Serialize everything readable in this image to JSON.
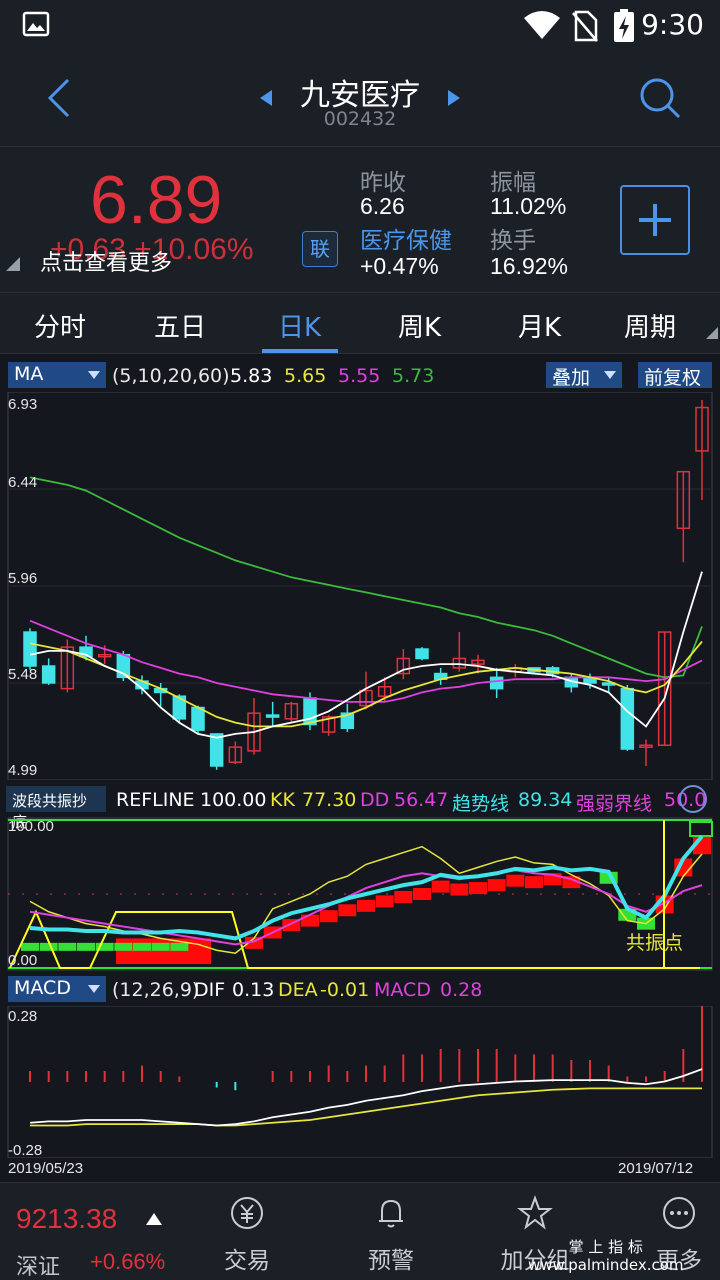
{
  "status_bar": {
    "time": "9:30"
  },
  "header": {
    "stock_name": "九安医疗",
    "stock_code": "002432"
  },
  "quote": {
    "price": "6.89",
    "change": "+0.63  +10.06%",
    "tip": "点击查看更多",
    "link_badge": "联",
    "prev_close_label": "昨收",
    "prev_close": "6.26",
    "amplitude_label": "振幅",
    "amplitude": "11.02%",
    "sector_label": "医疗保健",
    "sector_change": "+0.47%",
    "turnover_label": "换手",
    "turnover": "16.92%",
    "colors": {
      "up": "#e0323c",
      "down": "#41e2e8",
      "accent": "#4b95ea"
    }
  },
  "tabs": [
    "分时",
    "五日",
    "日K",
    "周K",
    "月K",
    "周期"
  ],
  "active_tab": "日K",
  "ma_legend": {
    "selector": "MA",
    "params": "(5,10,20,60)",
    "ma5": "5.83",
    "ma10": "5.65",
    "ma20": "5.55",
    "ma60": "5.73",
    "overlay": "叠加",
    "adjust": "前复权"
  },
  "price_axis": {
    "top": "6.93",
    "mid1": "6.44",
    "mid2": "5.96",
    "mid3": "5.48",
    "bottom": "4.99"
  },
  "indicator_legend": {
    "name": "波段共振抄底",
    "refline_label": "REFLINE",
    "refline": "100.00",
    "kk_label": "KK",
    "kk": "77.30",
    "dd_label": "DD",
    "dd": "56.47",
    "trend_label": "趋势线",
    "trend": "89.34",
    "strength_label": "强弱界线",
    "strength": "50.0",
    "axis_top": "100.00",
    "axis_bottom": "0.00",
    "annotation": "共振点"
  },
  "macd_legend": {
    "selector": "MACD",
    "params": "(12,26,9)",
    "dif_label": "DIF",
    "dif": "0.13",
    "dea_label": "DEA",
    "dea": "-0.01",
    "macd_label": "MACD",
    "macd": "0.28",
    "axis_top": "0.28",
    "axis_bottom": "-0.28"
  },
  "date_axis": {
    "start": "2019/05/23",
    "end": "2019/07/12"
  },
  "chart_data": {
    "type": "candlestick",
    "x_range": [
      "2019/05/23",
      "2019/07/12"
    ],
    "ylim": [
      4.99,
      6.93
    ],
    "candles": [
      {
        "o": 5.7,
        "c": 5.52,
        "h": 5.72,
        "l": 5.5
      },
      {
        "o": 5.52,
        "c": 5.43,
        "h": 5.56,
        "l": 5.42
      },
      {
        "o": 5.4,
        "c": 5.62,
        "h": 5.66,
        "l": 5.38
      },
      {
        "o": 5.62,
        "c": 5.57,
        "h": 5.68,
        "l": 5.55
      },
      {
        "o": 5.58,
        "c": 5.58,
        "h": 5.63,
        "l": 5.53
      },
      {
        "o": 5.58,
        "c": 5.46,
        "h": 5.6,
        "l": 5.44
      },
      {
        "o": 5.44,
        "c": 5.4,
        "h": 5.47,
        "l": 5.37
      },
      {
        "o": 5.4,
        "c": 5.38,
        "h": 5.43,
        "l": 5.3
      },
      {
        "o": 5.36,
        "c": 5.24,
        "h": 5.37,
        "l": 5.22
      },
      {
        "o": 5.3,
        "c": 5.18,
        "h": 5.31,
        "l": 5.16
      },
      {
        "o": 5.16,
        "c": 4.99,
        "h": 5.16,
        "l": 4.97
      },
      {
        "o": 5.01,
        "c": 5.09,
        "h": 5.12,
        "l": 5.0
      },
      {
        "o": 5.07,
        "c": 5.27,
        "h": 5.35,
        "l": 5.05
      },
      {
        "o": 5.26,
        "c": 5.25,
        "h": 5.33,
        "l": 5.2
      },
      {
        "o": 5.24,
        "c": 5.32,
        "h": 5.33,
        "l": 5.22
      },
      {
        "o": 5.35,
        "c": 5.21,
        "h": 5.38,
        "l": 5.18
      },
      {
        "o": 5.17,
        "c": 5.25,
        "h": 5.26,
        "l": 5.15
      },
      {
        "o": 5.27,
        "c": 5.19,
        "h": 5.32,
        "l": 5.17
      },
      {
        "o": 5.31,
        "c": 5.39,
        "h": 5.49,
        "l": 5.29
      },
      {
        "o": 5.36,
        "c": 5.41,
        "h": 5.46,
        "l": 5.33
      },
      {
        "o": 5.48,
        "c": 5.56,
        "h": 5.61,
        "l": 5.45
      },
      {
        "o": 5.61,
        "c": 5.56,
        "h": 5.62,
        "l": 5.55
      },
      {
        "o": 5.48,
        "c": 5.45,
        "h": 5.51,
        "l": 5.42
      },
      {
        "o": 5.51,
        "c": 5.56,
        "h": 5.7,
        "l": 5.49
      },
      {
        "o": 5.53,
        "c": 5.55,
        "h": 5.58,
        "l": 5.48
      },
      {
        "o": 5.46,
        "c": 5.4,
        "h": 5.51,
        "l": 5.35
      },
      {
        "o": 5.49,
        "c": 5.51,
        "h": 5.53,
        "l": 5.46
      },
      {
        "o": 5.51,
        "c": 5.49,
        "h": 5.51,
        "l": 5.48
      },
      {
        "o": 5.51,
        "c": 5.48,
        "h": 5.52,
        "l": 5.46
      },
      {
        "o": 5.46,
        "c": 5.41,
        "h": 5.48,
        "l": 5.38
      },
      {
        "o": 5.46,
        "c": 5.43,
        "h": 5.48,
        "l": 5.4
      },
      {
        "o": 5.43,
        "c": 5.42,
        "h": 5.46,
        "l": 5.38
      },
      {
        "o": 5.4,
        "c": 5.08,
        "h": 5.42,
        "l": 5.07
      },
      {
        "o": 5.1,
        "c": 5.1,
        "h": 5.13,
        "l": 4.99
      },
      {
        "o": 5.1,
        "c": 5.7,
        "h": 5.7,
        "l": 5.1
      },
      {
        "o": 6.25,
        "c": 6.55,
        "h": 6.55,
        "l": 6.07
      },
      {
        "o": 6.66,
        "c": 6.89,
        "h": 6.93,
        "l": 6.4
      }
    ],
    "ma5": [
      5.58,
      5.6,
      5.6,
      5.58,
      5.52,
      5.48,
      5.4,
      5.3,
      5.22,
      5.16,
      5.14,
      5.16,
      5.17,
      5.2,
      5.22,
      5.24,
      5.28,
      5.34,
      5.4,
      5.45,
      5.5,
      5.52,
      5.53,
      5.53,
      5.52,
      5.5,
      5.49,
      5.48,
      5.47,
      5.44,
      5.42,
      5.38,
      5.28,
      5.2,
      5.35,
      5.7,
      6.02
    ],
    "ma10": [
      5.64,
      5.62,
      5.6,
      5.56,
      5.52,
      5.48,
      5.44,
      5.4,
      5.35,
      5.3,
      5.25,
      5.22,
      5.2,
      5.2,
      5.2,
      5.22,
      5.24,
      5.26,
      5.3,
      5.35,
      5.39,
      5.42,
      5.45,
      5.47,
      5.49,
      5.5,
      5.51,
      5.5,
      5.49,
      5.48,
      5.46,
      5.44,
      5.4,
      5.38,
      5.42,
      5.53,
      5.65
    ],
    "ma20": [
      5.76,
      5.72,
      5.68,
      5.64,
      5.61,
      5.58,
      5.54,
      5.51,
      5.48,
      5.46,
      5.43,
      5.41,
      5.39,
      5.37,
      5.36,
      5.35,
      5.34,
      5.33,
      5.33,
      5.33,
      5.35,
      5.38,
      5.4,
      5.41,
      5.43,
      5.44,
      5.45,
      5.45,
      5.45,
      5.46,
      5.46,
      5.46,
      5.45,
      5.44,
      5.45,
      5.5,
      5.55
    ],
    "ma60": [
      6.52,
      6.5,
      6.48,
      6.45,
      6.4,
      6.35,
      6.3,
      6.25,
      6.2,
      6.16,
      6.12,
      6.08,
      6.05,
      6.02,
      5.99,
      5.97,
      5.95,
      5.93,
      5.91,
      5.89,
      5.87,
      5.85,
      5.83,
      5.8,
      5.78,
      5.75,
      5.73,
      5.71,
      5.68,
      5.64,
      5.6,
      5.56,
      5.52,
      5.48,
      5.46,
      5.47,
      5.73
    ]
  }
}
